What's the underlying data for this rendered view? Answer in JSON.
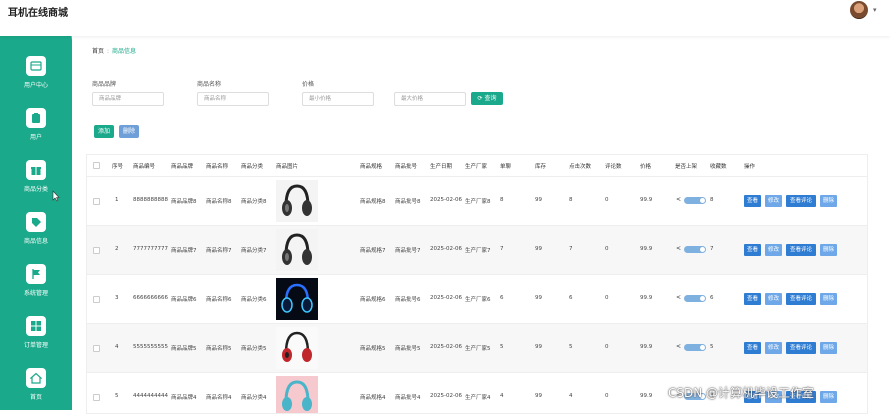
{
  "app": {
    "title": "耳机在线商城"
  },
  "sidebar": {
    "items": [
      {
        "label": "用户中心",
        "icon": "user-center-icon"
      },
      {
        "label": "用户",
        "icon": "clipboard-icon"
      },
      {
        "label": "商品分类",
        "icon": "gift-icon"
      },
      {
        "label": "商品信息",
        "icon": "tag-icon"
      },
      {
        "label": "系统管理",
        "icon": "flag-icon"
      },
      {
        "label": "订单管理",
        "icon": "grid-icon"
      },
      {
        "label": "首页",
        "icon": "home-icon"
      }
    ]
  },
  "breadcrumb": {
    "home": "首页",
    "sep": ":",
    "current": "商品信息"
  },
  "search": {
    "brand_label": "商品品牌",
    "brand_placeholder": "商品品牌",
    "name_label": "商品名称",
    "name_placeholder": "商品名称",
    "price_label": "价格",
    "min_placeholder": "最小价格",
    "max_placeholder": "最大价格",
    "query_label": "查询"
  },
  "toolbar": {
    "add_label": "添加",
    "delete_label": "删除"
  },
  "table": {
    "headers": [
      "序号",
      "商品编号",
      "商品品牌",
      "商品名称",
      "商品分类",
      "商品图片",
      "商品规格",
      "商品批号",
      "生产日期",
      "生产厂家",
      "单聊",
      "库存",
      "点击次数",
      "评论数",
      "价格",
      "是否上架",
      "收藏数",
      "操作"
    ],
    "rows": [
      {
        "no": "1",
        "code": "8888888888",
        "brand": "商品品牌8",
        "name": "商品名称8",
        "cat": "商品分类8",
        "spec": "商品规格8",
        "batch": "商品批号8",
        "date": "2025-02-06",
        "maker": "生产厂家8",
        "chat": "8",
        "stock": "99",
        "clicks": "8",
        "comments": "0",
        "price": "99.9",
        "fav": "8",
        "img": "dark"
      },
      {
        "no": "2",
        "code": "7777777777",
        "brand": "商品品牌7",
        "name": "商品名称7",
        "cat": "商品分类7",
        "spec": "商品规格7",
        "batch": "商品批号7",
        "date": "2025-02-06",
        "maker": "生产厂家7",
        "chat": "7",
        "stock": "99",
        "clicks": "7",
        "comments": "0",
        "price": "99.9",
        "fav": "7",
        "img": "dark"
      },
      {
        "no": "3",
        "code": "6666666666",
        "brand": "商品品牌6",
        "name": "商品名称6",
        "cat": "商品分类6",
        "spec": "商品规格6",
        "batch": "商品批号6",
        "date": "2025-02-06",
        "maker": "生产厂家6",
        "chat": "6",
        "stock": "99",
        "clicks": "6",
        "comments": "0",
        "price": "99.9",
        "fav": "6",
        "img": "neon"
      },
      {
        "no": "4",
        "code": "5555555555",
        "brand": "商品品牌5",
        "name": "商品名称5",
        "cat": "商品分类5",
        "spec": "商品规格5",
        "batch": "商品批号5",
        "date": "2025-02-06",
        "maker": "生产厂家5",
        "chat": "5",
        "stock": "99",
        "clicks": "5",
        "comments": "0",
        "price": "99.9",
        "fav": "5",
        "img": "red"
      },
      {
        "no": "5",
        "code": "4444444444",
        "brand": "商品品牌4",
        "name": "商品名称4",
        "cat": "商品分类4",
        "spec": "商品规格4",
        "batch": "商品批号4",
        "date": "2025-02-06",
        "maker": "生产厂家4",
        "chat": "4",
        "stock": "99",
        "clicks": "4",
        "comments": "0",
        "price": "99.9",
        "fav": "4",
        "img": "pink"
      }
    ],
    "actions": [
      "查看",
      "修改",
      "查看评论",
      "删除"
    ]
  },
  "watermark": "CSDN @计算机毕设工作室",
  "colors": {
    "sidebar": "#1aa98a",
    "primary": "#2f7cd3",
    "accent": "#1aa98a"
  }
}
